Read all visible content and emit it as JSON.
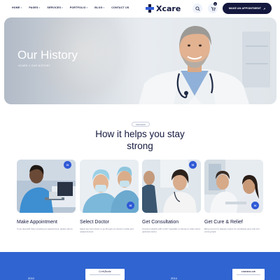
{
  "nav": {
    "items": [
      {
        "label": "HOME",
        "caret": "▾"
      },
      {
        "label": "PAGES",
        "caret": "▾"
      },
      {
        "label": "SERVICES",
        "caret": "▾"
      },
      {
        "label": "PORTFOLIO",
        "caret": "▾"
      },
      {
        "label": "BLOG",
        "caret": "▾"
      },
      {
        "label": "CONTACT US",
        "caret": ""
      }
    ],
    "logo_text": "Xcare",
    "cart_count": "0",
    "appointment_label": "MAKE AN APPOINTMENT",
    "appointment_arrow": "↗"
  },
  "hero": {
    "title": "Our History",
    "breadcrumb": "XCARE // OUR HISTORY"
  },
  "section": {
    "tag": "PROCESS",
    "title_line1": "How it helps you stay",
    "title_line2": "strong"
  },
  "cards": [
    {
      "num": "01",
      "title": "Make Appointment",
      "desc": "If you deal with help in booking an appointment, please call us."
    },
    {
      "num": "02",
      "title": "Select Doctor",
      "desc": "Select any best doctor or go through our doctor's profile and related doctors."
    },
    {
      "num": "03",
      "title": "Get Consultation",
      "desc": "Connect instantly with a 24x7 specialist or choose to video visit a particular doctor."
    },
    {
      "num": "04",
      "title": "Get Cure & Relief",
      "desc": "Being cured of a disease means it's completely gone and isn't coming back."
    }
  ],
  "timeline": {
    "years": [
      "2010",
      "2014"
    ],
    "cert1": "Certificate",
    "cert2": "CERTIFICATE"
  },
  "colors": {
    "navy": "#14183e",
    "accent": "#2f5ad6",
    "band": "#3064d0"
  }
}
